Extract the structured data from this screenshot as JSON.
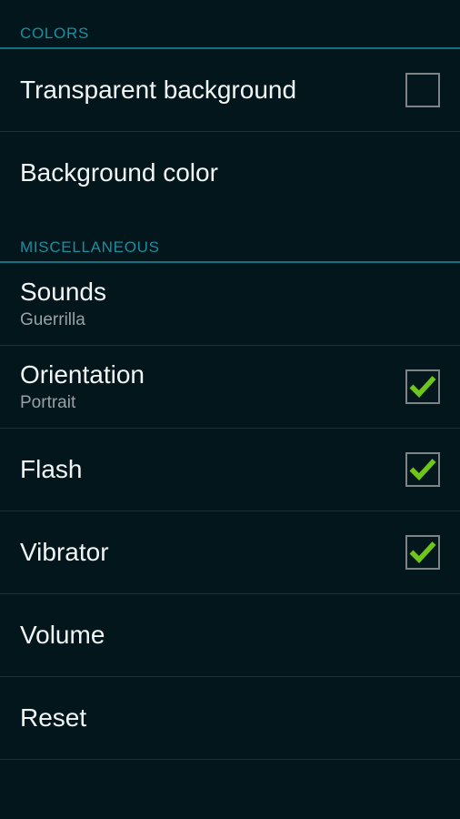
{
  "theme": {
    "background": "#02161b",
    "accent_teal": "#1a8e9e",
    "rule_teal": "#12727f",
    "divider": "#1d3036",
    "title_text": "#f2f5f6",
    "subtitle_text": "#9aa1a4",
    "checkbox_border": "#7d8386",
    "check_green": "#6ec61a"
  },
  "sections": [
    {
      "header": "COLORS",
      "rows": [
        {
          "title": "Transparent background",
          "subtitle": "",
          "control": "checkbox",
          "checked": false
        },
        {
          "title": "Background color",
          "subtitle": "",
          "control": "none",
          "checked": false
        }
      ]
    },
    {
      "header": "MISCELLANEOUS",
      "rows": [
        {
          "title": "Sounds",
          "subtitle": "Guerrilla",
          "control": "none",
          "checked": false
        },
        {
          "title": "Orientation",
          "subtitle": "Portrait",
          "control": "checkbox",
          "checked": true
        },
        {
          "title": "Flash",
          "subtitle": "",
          "control": "checkbox",
          "checked": true
        },
        {
          "title": "Vibrator",
          "subtitle": "",
          "control": "checkbox",
          "checked": true
        },
        {
          "title": "Volume",
          "subtitle": "",
          "control": "none",
          "checked": false
        },
        {
          "title": "Reset",
          "subtitle": "",
          "control": "none",
          "checked": false
        }
      ]
    }
  ]
}
